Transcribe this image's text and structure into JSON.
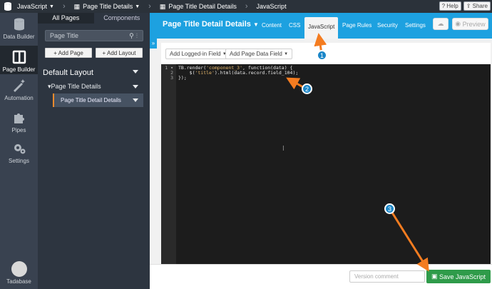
{
  "topbar": {
    "crumbs": [
      "JavaScript",
      "Page Title Details",
      "Page Title Detail Details",
      "JavaScript"
    ],
    "help": "Help",
    "share": "Share"
  },
  "rail": {
    "items": [
      "Data Builder",
      "Page Builder",
      "Automation",
      "Pipes",
      "Settings"
    ],
    "user": "Tadabase"
  },
  "panel": {
    "tabs": [
      "All Pages",
      "Components"
    ],
    "search_value": "Page Title",
    "add_page": "+ Add Page",
    "add_layout": "+ Add Layout",
    "default_layout": "Default Layout",
    "page_item": "Page Title Details",
    "sub_item": "Page Title Detail Details"
  },
  "content": {
    "page_title": "Page Title Detail Details",
    "nav": [
      "Content",
      "CSS",
      "JavaScript",
      "Page Rules",
      "Security",
      "Settings"
    ],
    "preview": "Preview",
    "add_logged_in": "Add Logged-in Field",
    "add_page_data": "Add Page Data Field",
    "code": {
      "line1_a": "TB.render(",
      "line1_str": "'component_3'",
      "line1_b": ", function(data) {",
      "line2_a": "    $(",
      "line2_str": "'title'",
      "line2_b": ").html(data.record.field_104);",
      "line3": "});"
    },
    "version_placeholder": "Version comment",
    "save": "Save JavaScript"
  },
  "annotations": [
    "1",
    "2",
    "3"
  ],
  "colors": {
    "accent_blue": "#1da1e0",
    "arrow_orange": "#f47c20",
    "save_green": "#2f9b4a"
  }
}
